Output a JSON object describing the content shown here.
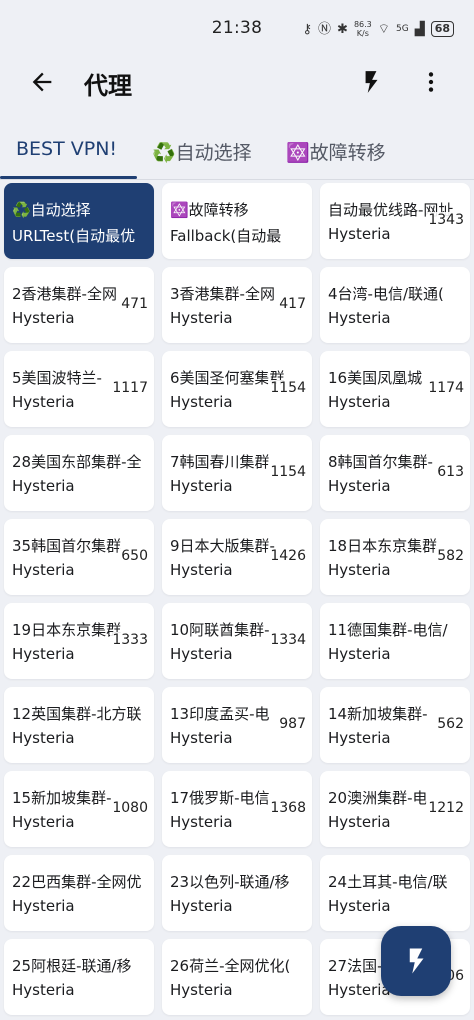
{
  "status": {
    "time": "21:38",
    "speed_value": "86.3",
    "speed_unit": "K/s",
    "network": "5G",
    "battery": "68"
  },
  "appbar": {
    "title": "代理"
  },
  "tabs": [
    {
      "label": "BEST VPN!"
    },
    {
      "label": "♻️自动选择"
    },
    {
      "label": "🔯故障转移"
    }
  ],
  "cards": [
    {
      "name": "♻️自动选择",
      "type": "URLTest(自动最优",
      "delay": "",
      "selected": true
    },
    {
      "name": "🔯故障转移",
      "type": "Fallback(自动最",
      "delay": ""
    },
    {
      "name": "自动最优线路-网址",
      "type": "Hysteria",
      "delay": "1343"
    },
    {
      "name": "2香港集群-全网",
      "type": "Hysteria",
      "delay": "471"
    },
    {
      "name": "3香港集群-全网",
      "type": "Hysteria",
      "delay": "417"
    },
    {
      "name": "4台湾-电信/联通(",
      "type": "Hysteria",
      "delay": ""
    },
    {
      "name": "5美国波特兰-",
      "type": "Hysteria",
      "delay": "1117"
    },
    {
      "name": "6美国圣何塞集群",
      "type": "Hysteria",
      "delay": "1154"
    },
    {
      "name": "16美国凤凰城",
      "type": "Hysteria",
      "delay": "1174"
    },
    {
      "name": "28美国东部集群-全",
      "type": "Hysteria",
      "delay": ""
    },
    {
      "name": "7韩国春川集群",
      "type": "Hysteria",
      "delay": "1154"
    },
    {
      "name": "8韩国首尔集群-",
      "type": "Hysteria",
      "delay": "613"
    },
    {
      "name": "35韩国首尔集群",
      "type": "Hysteria",
      "delay": "650"
    },
    {
      "name": "9日本大版集群-",
      "type": "Hysteria",
      "delay": "1426"
    },
    {
      "name": "18日本东京集群",
      "type": "Hysteria",
      "delay": "582"
    },
    {
      "name": "19日本东京集群",
      "type": "Hysteria",
      "delay": "1333"
    },
    {
      "name": "10阿联酋集群-",
      "type": "Hysteria",
      "delay": "1334"
    },
    {
      "name": "11德国集群-电信/",
      "type": "Hysteria",
      "delay": ""
    },
    {
      "name": "12英国集群-北方联",
      "type": "Hysteria",
      "delay": ""
    },
    {
      "name": "13印度孟买-电",
      "type": "Hysteria",
      "delay": "987"
    },
    {
      "name": "14新加坡集群-",
      "type": "Hysteria",
      "delay": "562"
    },
    {
      "name": "15新加坡集群-",
      "type": "Hysteria",
      "delay": "1080"
    },
    {
      "name": "17俄罗斯-电信",
      "type": "Hysteria",
      "delay": "1368"
    },
    {
      "name": "20澳洲集群-电",
      "type": "Hysteria",
      "delay": "1212"
    },
    {
      "name": "22巴西集群-全网优",
      "type": "Hysteria",
      "delay": ""
    },
    {
      "name": "23以色列-联通/移",
      "type": "Hysteria",
      "delay": ""
    },
    {
      "name": "24土耳其-电信/联",
      "type": "Hysteria",
      "delay": ""
    },
    {
      "name": "25阿根廷-联通/移",
      "type": "Hysteria",
      "delay": ""
    },
    {
      "name": "26荷兰-全网优化(",
      "type": "Hysteria",
      "delay": ""
    },
    {
      "name": "27法国-",
      "type": "Hysteria",
      "delay": "06"
    }
  ],
  "colors": {
    "accent": "#1f3f73",
    "background": "#eef0f5",
    "card": "#ffffff"
  },
  "icons": {
    "back": "arrow-left-icon",
    "bolt": "lightning-icon",
    "more": "more-vertical-icon",
    "fab": "lightning-icon"
  }
}
